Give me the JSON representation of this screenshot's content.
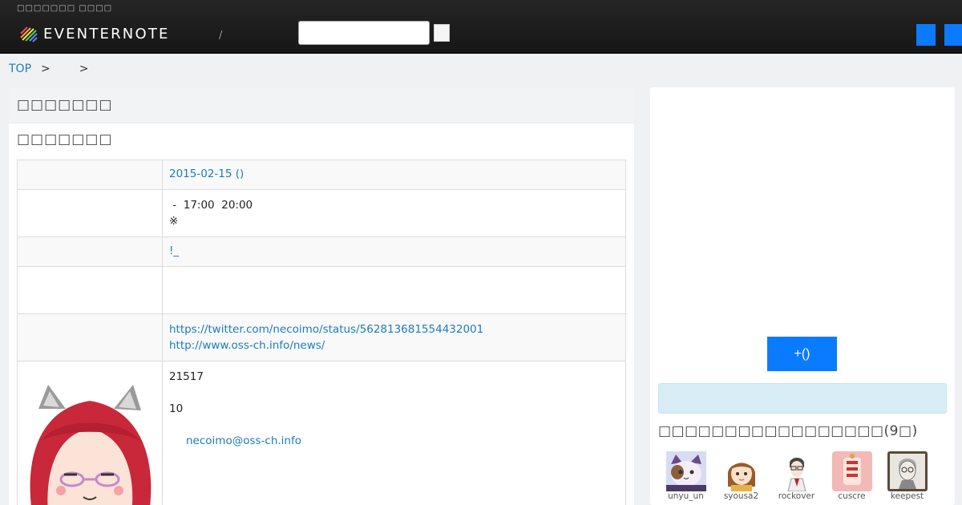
{
  "header": {
    "tagline": "□□□□□□□ □□□□",
    "logo_text": "EVENTERNOTE",
    "nav_slash": "/",
    "search_placeholder": ""
  },
  "breadcrumb": {
    "top": "TOP",
    "sep1": ">",
    "sep2": ">"
  },
  "main": {
    "section_title": "□□□□□□□",
    "event_title": "□□□□□□□",
    "rows": {
      "date": "2015-02-15 ()",
      "time_line1": " -  17:00  20:00",
      "time_line2": "※",
      "place": "!_",
      "link1": "https://twitter.com/necoimo/status/562813681554432001",
      "link2": "http://www.oss-ch.info/news/",
      "detail1": "21517",
      "detail2": "10",
      "detail_email": "necoimo@oss-ch.info"
    }
  },
  "sidebar": {
    "join_button": "+()",
    "members_title": "□□□□□□□□□□□□□□□□□(9□)",
    "members": [
      {
        "name": "unyu_un"
      },
      {
        "name": "syousa2"
      },
      {
        "name": "rockover"
      },
      {
        "name": "cuscre"
      },
      {
        "name": "keepest"
      }
    ]
  },
  "colors": {
    "accent": "#0a7bff",
    "link": "#1a7cc3",
    "header_bg": "#1e1e1e",
    "info_box": "#d9edf7"
  }
}
